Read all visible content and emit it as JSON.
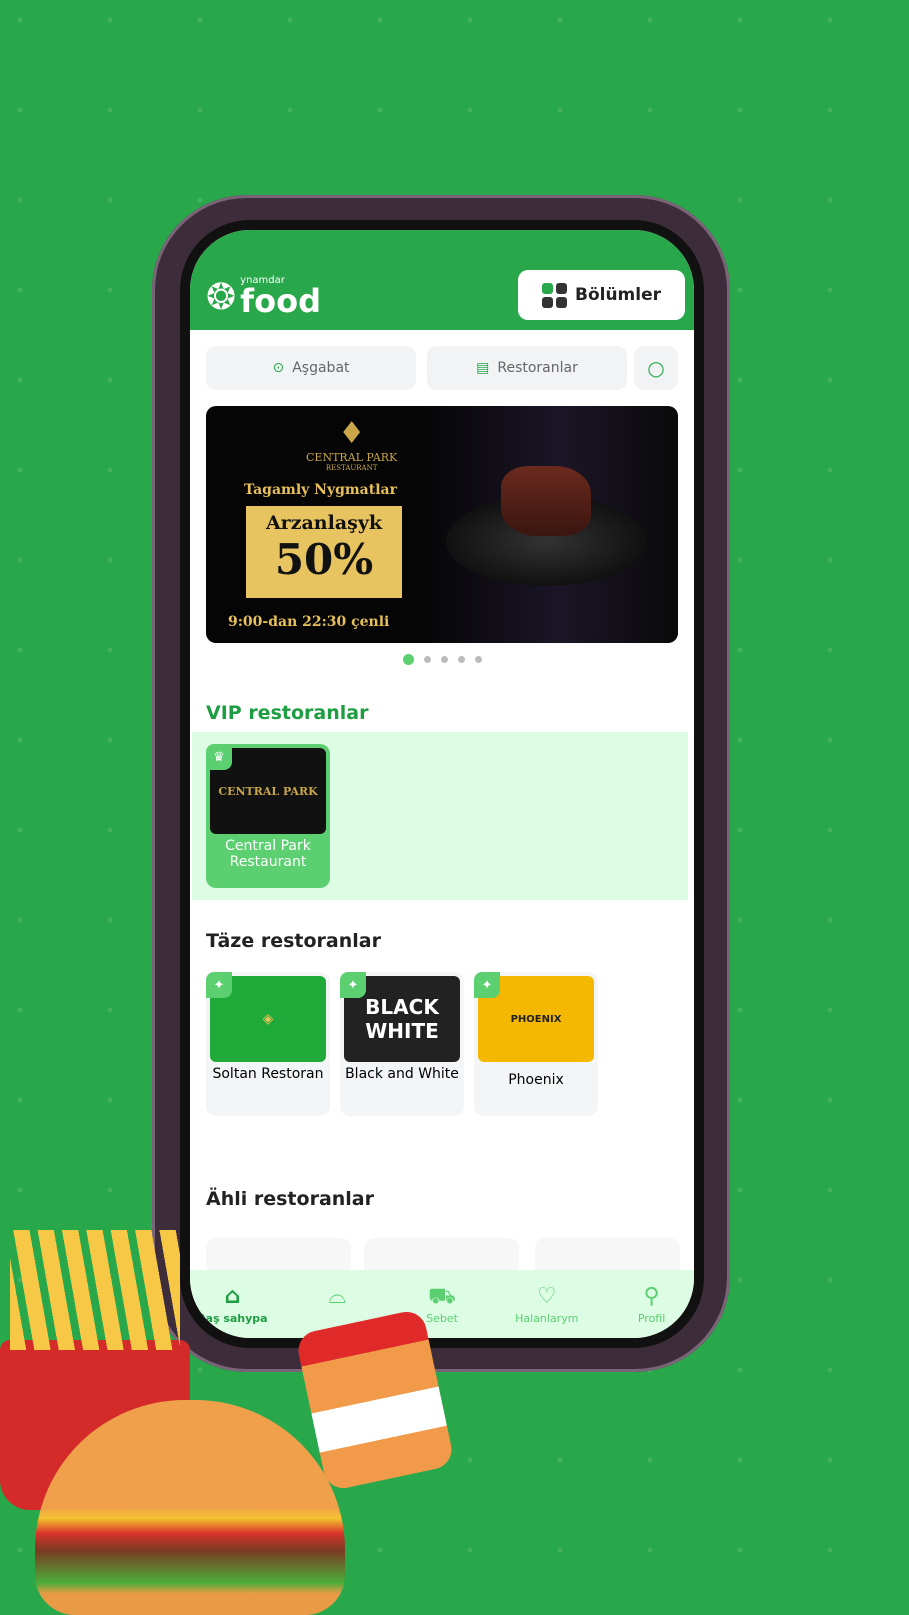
{
  "header": {
    "logo_small": "ynamdar",
    "logo_big": "food",
    "sections_button": "Bölümler"
  },
  "search": {
    "city": "Aşgabat",
    "category": "Restoranlar"
  },
  "banner": {
    "brand": "CENTRAL PARK",
    "brand_sub": "RESTAURANT",
    "line1": "Tagamly Nygmatlar",
    "discount_label": "Arzanlaşyk",
    "discount": "50%",
    "hours": "9:00-dan  22:30 çenli",
    "slides": 5,
    "active_slide": 1
  },
  "vip": {
    "title": "VIP restoranlar",
    "items": [
      {
        "name": "Central Park Restaurant",
        "logo": "CENTRAL PARK"
      }
    ]
  },
  "fresh": {
    "title": "Täze restoranlar",
    "items": [
      {
        "name": "Soltan Restoran",
        "logo": ""
      },
      {
        "name": "Black and White",
        "logo": "BLACK WHITE"
      },
      {
        "name": "Phoenix",
        "logo": "PHOENIX"
      }
    ]
  },
  "popular": {
    "title": "Ähli restoranlar"
  },
  "nav": [
    {
      "label": "Baş sahypa",
      "icon": "home-icon",
      "active": true
    },
    {
      "label": "",
      "icon": "cloche-icon"
    },
    {
      "label": "Sebet",
      "icon": "cart-icon"
    },
    {
      "label": "Halanlarym",
      "icon": "heart-icon"
    },
    {
      "label": "Profil",
      "icon": "user-icon"
    }
  ],
  "colors": {
    "brand": "#28a84a",
    "accent": "#5ccf70",
    "vip_bg": "#dcfce4"
  }
}
